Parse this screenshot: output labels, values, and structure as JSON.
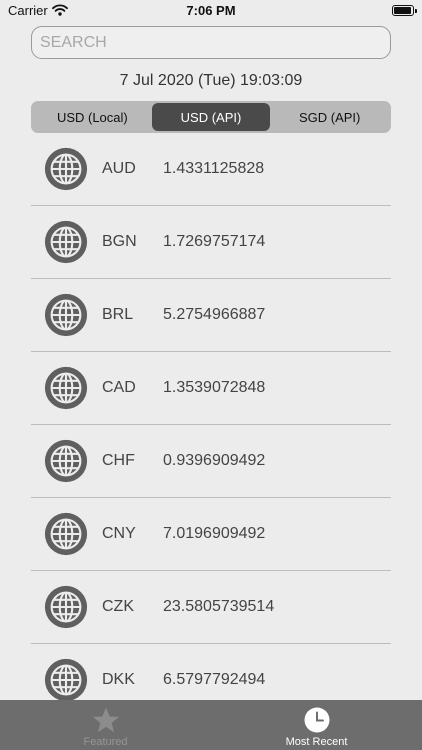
{
  "status_bar": {
    "carrier": "Carrier",
    "time": "7:06 PM"
  },
  "search": {
    "placeholder": "SEARCH"
  },
  "datetime": "7 Jul 2020 (Tue) 19:03:09",
  "segments": [
    {
      "label": "USD (Local)",
      "selected": false
    },
    {
      "label": "USD (API)",
      "selected": true
    },
    {
      "label": "SGD (API)",
      "selected": false
    }
  ],
  "rates": [
    {
      "code": "AUD",
      "rate": "1.4331125828",
      "icon": "globe-icon"
    },
    {
      "code": "BGN",
      "rate": "1.7269757174",
      "icon": "globe-icon"
    },
    {
      "code": "BRL",
      "rate": "5.2754966887",
      "icon": "globe-icon"
    },
    {
      "code": "CAD",
      "rate": "1.3539072848",
      "icon": "globe-icon"
    },
    {
      "code": "CHF",
      "rate": "0.9396909492",
      "icon": "globe-icon"
    },
    {
      "code": "CNY",
      "rate": "7.0196909492",
      "icon": "globe-icon"
    },
    {
      "code": "CZK",
      "rate": "23.5805739514",
      "icon": "globe-icon"
    },
    {
      "code": "DKK",
      "rate": "6.5797792494",
      "icon": "globe-icon"
    }
  ],
  "tabbar": {
    "featured": {
      "label": "Featured",
      "icon": "star-icon"
    },
    "recent": {
      "label": "Most Recent",
      "icon": "clock-icon"
    }
  },
  "colors": {
    "background": "#ececec",
    "segment_active": "#4a4a4a",
    "tabbar": "#6d6d6d",
    "icon": "#5f5f5f"
  }
}
